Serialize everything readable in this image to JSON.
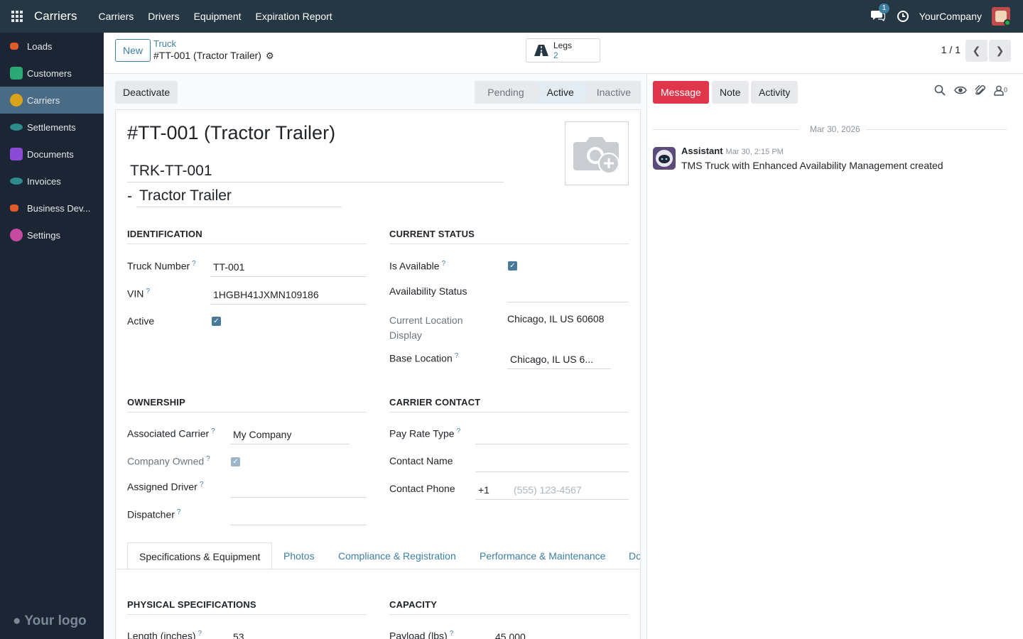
{
  "topbar": {
    "app_name": "Carriers",
    "menu": [
      "Carriers",
      "Drivers",
      "Equipment",
      "Expiration Report"
    ],
    "chat_count": "1",
    "company": "YourCompany"
  },
  "sidebar": {
    "items": [
      {
        "label": "Loads",
        "color": "#e05a2b"
      },
      {
        "label": "Customers",
        "color": "#2aa876"
      },
      {
        "label": "Carriers",
        "color": "#d9a21b"
      },
      {
        "label": "Settlements",
        "color": "#2e8b8b"
      },
      {
        "label": "Documents",
        "color": "#8c4bd6"
      },
      {
        "label": "Invoices",
        "color": "#2e8b8b"
      },
      {
        "label": "Business Dev...",
        "color": "#e05a2b"
      },
      {
        "label": "Settings",
        "color": "#c84aa0"
      }
    ],
    "logo": "Your logo"
  },
  "control": {
    "new_label": "New",
    "breadcrumb_parent": "Truck",
    "breadcrumb_current": "#TT-001 (Tractor Trailer)",
    "legs_label": "Legs",
    "legs_count": "2",
    "pager": "1 / 1"
  },
  "statusbar": {
    "deactivate_label": "Deactivate",
    "stages": [
      "Pending",
      "Active",
      "Inactive"
    ],
    "active_stage": "Active"
  },
  "record": {
    "title": "#TT-001 (Tractor Trailer)",
    "code": "TRK-TT-001",
    "dash": "-",
    "type": "Tractor Trailer"
  },
  "identification": {
    "heading": "IDENTIFICATION",
    "truck_number_label": "Truck Number",
    "truck_number": "TT-001",
    "vin_label": "VIN",
    "vin": "1HGBH41JXMN109186",
    "active_label": "Active",
    "active": true
  },
  "current_status": {
    "heading": "CURRENT STATUS",
    "is_available_label": "Is Available",
    "is_available": true,
    "availability_status_label": "Availability Status",
    "availability_status": "",
    "current_location_label": "Current Location Display",
    "current_location": "Chicago, IL US 60608",
    "base_location_label": "Base Location",
    "base_location": "Chicago, IL US 6..."
  },
  "ownership": {
    "heading": "OWNERSHIP",
    "associated_carrier_label": "Associated Carrier",
    "associated_carrier": "My Company",
    "company_owned_label": "Company Owned",
    "company_owned": true,
    "assigned_driver_label": "Assigned Driver",
    "assigned_driver": "",
    "dispatcher_label": "Dispatcher",
    "dispatcher": ""
  },
  "carrier_contact": {
    "heading": "CARRIER CONTACT",
    "pay_rate_type_label": "Pay Rate Type",
    "pay_rate_type": "",
    "contact_name_label": "Contact Name",
    "contact_name": "",
    "contact_phone_label": "Contact Phone",
    "phone_prefix": "+1",
    "phone_placeholder": "(555) 123-4567"
  },
  "tabs": [
    "Specifications & Equipment",
    "Photos",
    "Compliance & Registration",
    "Performance & Maintenance",
    "Do"
  ],
  "physical": {
    "heading": "PHYSICAL SPECIFICATIONS",
    "length_label": "Length (inches)",
    "length": "53"
  },
  "capacity": {
    "heading": "CAPACITY",
    "payload_label": "Payload (lbs)",
    "payload": "45,000"
  },
  "chatter": {
    "message_label": "Message",
    "note_label": "Note",
    "activity_label": "Activity",
    "follower_count": "0",
    "date_divider": "Mar 30, 2026",
    "author": "Assistant",
    "time": "Mar 30, 2:15 PM",
    "body": "TMS Truck with Enhanced Availability Management created"
  }
}
